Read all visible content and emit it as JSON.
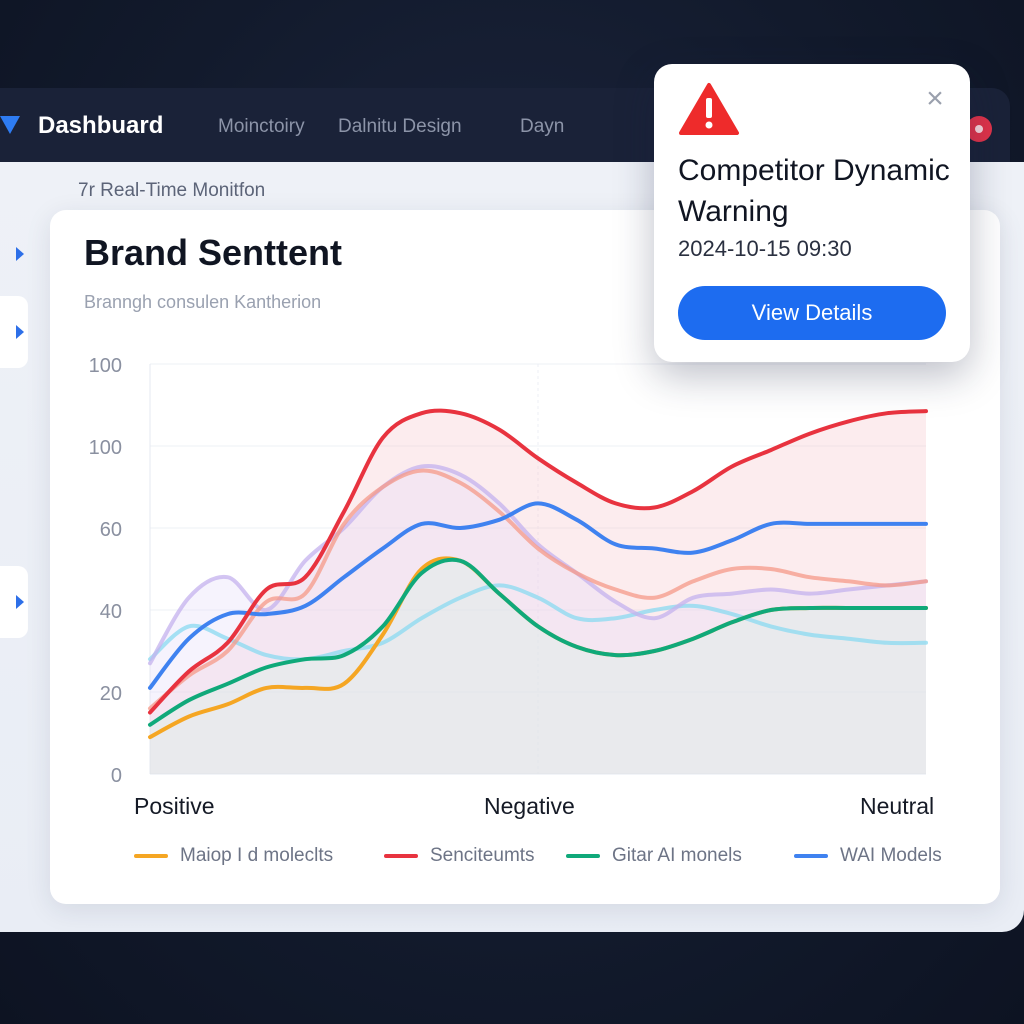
{
  "app": {
    "brand": "Dashbuard",
    "nav": [
      "Moinctoiry",
      "Dalnitu Design",
      "Dayn"
    ]
  },
  "section_title": "7r Real-Time Monitfon",
  "card": {
    "title": "Brand Senttent",
    "subtitle": "Branngh consulen Kantherion"
  },
  "alert": {
    "title": "Competitor Dynamic Warning",
    "timestamp": "2024-10-15 09:30",
    "button_label": "View Details",
    "close_icon": "close-icon",
    "warning_icon": "warning-triangle-icon"
  },
  "chart_data": {
    "type": "line",
    "title": "Brand Senttent",
    "y_tick_labels": [
      "0",
      "20",
      "40",
      "60",
      "100",
      "100"
    ],
    "ylim": [
      0,
      100
    ],
    "grid": true,
    "categories": [
      "Positive",
      "Negative",
      "Neutral"
    ],
    "x": [
      0,
      0.5,
      1,
      1.5,
      2,
      2.5,
      3,
      3.5,
      4,
      4.5,
      5,
      5.5,
      6,
      6.5,
      7,
      7.5,
      8,
      8.5,
      9,
      9.5,
      10
    ],
    "legend": [
      {
        "name": "Maiop I d moleclts",
        "color": "#f5a623"
      },
      {
        "name": "Senciteumts",
        "color": "#e8333f"
      },
      {
        "name": "Gitar AI monels",
        "color": "#10a97a"
      },
      {
        "name": "WAI Models",
        "color": "#3f82f0"
      }
    ],
    "series": [
      {
        "color": "#f5a623",
        "values": [
          9,
          14,
          17,
          21,
          21,
          22,
          34,
          50,
          52,
          44,
          36,
          31,
          29,
          30,
          33,
          37,
          40,
          40.5,
          40.5,
          40.5,
          40.5
        ]
      },
      {
        "color": "#e8333f",
        "values": [
          15,
          25,
          32,
          45,
          48,
          64,
          82,
          88,
          88,
          84,
          77,
          71,
          66,
          65,
          69,
          75,
          79,
          83,
          86,
          88,
          88.5
        ]
      },
      {
        "color": "#10a97a",
        "values": [
          12,
          18,
          22,
          26,
          28,
          29,
          36,
          49,
          52,
          44,
          36,
          31,
          29,
          30,
          33,
          37,
          40,
          40.5,
          40.5,
          40.5,
          40.5
        ]
      },
      {
        "color": "#3f82f0",
        "values": [
          21,
          33,
          39,
          39,
          41,
          48,
          55,
          61,
          60,
          62,
          66,
          62,
          56,
          55,
          54,
          57,
          61,
          61,
          61,
          61,
          61
        ]
      },
      {
        "color": "#c4b1ee",
        "values": [
          27,
          43,
          48,
          40,
          52,
          60,
          70,
          75,
          73,
          66,
          56,
          49,
          42,
          38,
          43,
          44,
          45,
          44,
          45,
          46,
          47
        ]
      },
      {
        "color": "#f59a88",
        "values": [
          16,
          24,
          30,
          42,
          44,
          61,
          70,
          74,
          71,
          64,
          55,
          49,
          45,
          43,
          47,
          50,
          50,
          48,
          47,
          46,
          47
        ]
      },
      {
        "color": "#8ad9f0",
        "values": [
          28,
          36,
          33,
          29,
          28,
          30,
          32,
          38,
          43,
          46,
          43,
          38,
          38,
          40,
          41,
          39,
          36,
          34,
          33,
          32,
          32
        ]
      }
    ]
  }
}
